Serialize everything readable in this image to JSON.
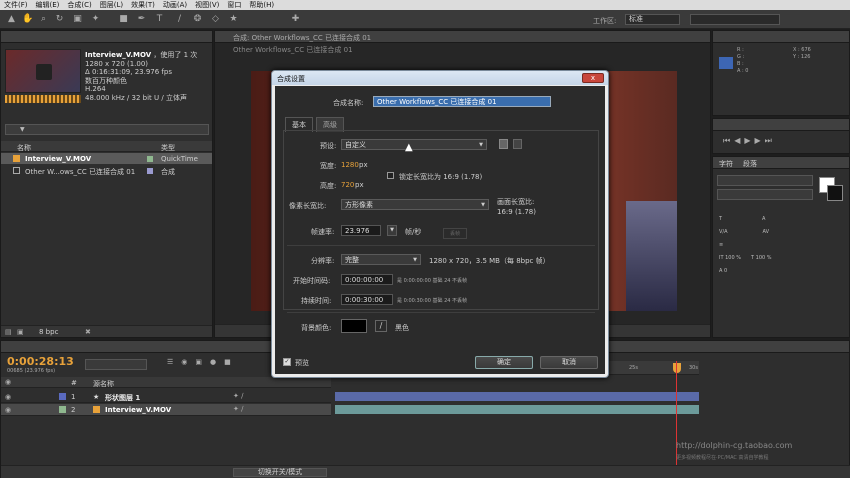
{
  "menu": [
    "文件(F)",
    "编辑(E)",
    "合成(C)",
    "图层(L)",
    "效果(T)",
    "动画(A)",
    "视图(V)",
    "窗口",
    "帮助(H)"
  ],
  "toolbar": {
    "workspace_label": "工作区:",
    "workspace_value": "标准"
  },
  "project": {
    "footage_name": "Interview_V.MOV",
    "footage_used": "，使用了 1 次",
    "footage_info": [
      "1280 x 720 (1.00)",
      "Δ 0:16:31:09, 23.976 fps",
      "数百万种颜色",
      "H.264",
      "48.000 kHz / 32 bit U / 立体声"
    ],
    "search_placeholder": "",
    "col_name": "名称",
    "col_type": "类型",
    "items": [
      {
        "name": "Interview_V.MOV",
        "type": "QuickTime",
        "color": "#8fb88f"
      },
      {
        "name": "Other W...ows_CC 已连接合成 01",
        "type": "合成",
        "color": "#9a9acf"
      }
    ],
    "bpc": "8 bpc"
  },
  "comp_tab": "合成: Other Workflows_CC 已连接合成 01",
  "comp_subtab": "Other Workflows_CC 已连接合成 01",
  "right_panels": {
    "info_rows": [
      "R :",
      "G :",
      "B :",
      "A : 0"
    ],
    "info_coords": [
      "X : 676",
      "Y : 126"
    ],
    "char_tab": "字符",
    "para_tab": "段落",
    "font_placeholder": "",
    "size_value": "100 %",
    "tracking_value": "0"
  },
  "timeline": {
    "timecode": "0:00:28:13",
    "frame_info": "00685 (23.976 fps)",
    "col_source": "源名称",
    "layers": [
      {
        "num": "1",
        "name": "形状图层 1",
        "color": "#5a6abf",
        "bar_color": "#5a6aa8"
      },
      {
        "num": "2",
        "name": "Interview_V.MOV",
        "color": "#8fb88f",
        "bar_color": "#6c9a9a"
      }
    ],
    "ruler": [
      "25s",
      "30s"
    ],
    "toggle_label": "切换开关/模式"
  },
  "dialog": {
    "title": "合成设置",
    "close": "x",
    "name_label": "合成名称:",
    "name_value": "Other Workflows_CC 已连接合成 01",
    "tabs": [
      "基本",
      "高级"
    ],
    "preset_label": "预设:",
    "preset_value": "自定义",
    "width_label": "宽度:",
    "width_value": "1280",
    "width_unit": "px",
    "height_label": "高度:",
    "height_value": "720",
    "height_unit": "px",
    "lock_label": "锁定长宽比为 16:9 (1.78)",
    "par_label": "像素长宽比:",
    "par_value": "方形像素",
    "frame_aspect_label": "画面长宽比:",
    "frame_aspect_value": "16:9 (1.78)",
    "fps_label": "帧速率:",
    "fps_value": "23.976",
    "fps_unit": "帧/秒",
    "drop_frame": "丢帧",
    "res_label": "分辨率:",
    "res_value": "完整",
    "res_info": "1280 x 720，3.5 MB（每 8bpc 帧）",
    "start_label": "开始时间码:",
    "start_value": "0:00:00:00",
    "start_info": "是 0:00:00:00  基础 24 不丢帧",
    "dur_label": "持续时间:",
    "dur_value": "0:00:30:00",
    "dur_info": "是 0:00:30:00  基础 24 不丢帧",
    "bg_label": "背景颜色:",
    "bg_name": "黑色",
    "preview_label": "预览",
    "ok": "确定",
    "cancel": "取消"
  },
  "watermark": {
    "url": "http://dolphin-cg.taobao.com",
    "sub": "更多视频教程尽在·PC/MAC 高清自学教程"
  }
}
